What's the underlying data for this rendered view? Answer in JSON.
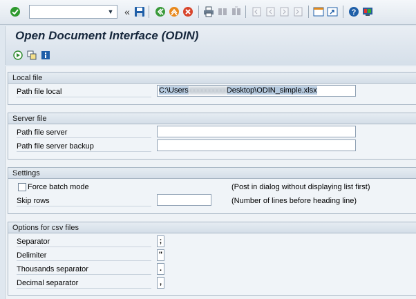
{
  "toolbar": {
    "command_field_value": "",
    "icons": [
      "enter-icon",
      "command-field",
      "back-double-arrow-icon",
      "save-icon",
      "back-icon",
      "exit-icon",
      "cancel-icon",
      "print-icon",
      "find-icon",
      "find-next-icon",
      "first-page-icon",
      "previous-page-icon",
      "next-page-icon",
      "last-page-icon",
      "create-session-icon",
      "shortcut-icon",
      "help-icon",
      "customize-layout-icon"
    ]
  },
  "page": {
    "title": "Open Document Interface (ODIN)"
  },
  "sections": {
    "local_file": {
      "title": "Local file",
      "path_label": "Path file local",
      "path_prefix": "C:\\Users",
      "path_suffix": "Desktop\\ODIN_simple.xlsx"
    },
    "server_file": {
      "title": "Server file",
      "path_label": "Path file server",
      "backup_label": "Path file server backup",
      "path_value": "",
      "backup_value": ""
    },
    "settings": {
      "title": "Settings",
      "force_batch_label": "Force batch mode",
      "force_batch_hint": "(Post in dialog without displaying list first)",
      "skip_rows_label": "Skip rows",
      "skip_rows_value": "",
      "skip_rows_hint": "(Number of lines before heading line)"
    },
    "csv_options": {
      "title": "Options for csv files",
      "separator_label": "Separator",
      "separator_value": ";",
      "delimiter_label": "Delimiter",
      "delimiter_value": "\"",
      "thousands_label": "Thousands separator",
      "thousands_value": ".",
      "decimal_label": "Decimal separator",
      "decimal_value": ","
    }
  },
  "colors": {
    "ok_green": "#2e9a2e",
    "nav_orange": "#e8891d",
    "cancel_red": "#d8452b",
    "save_blue": "#1f5fa8"
  }
}
